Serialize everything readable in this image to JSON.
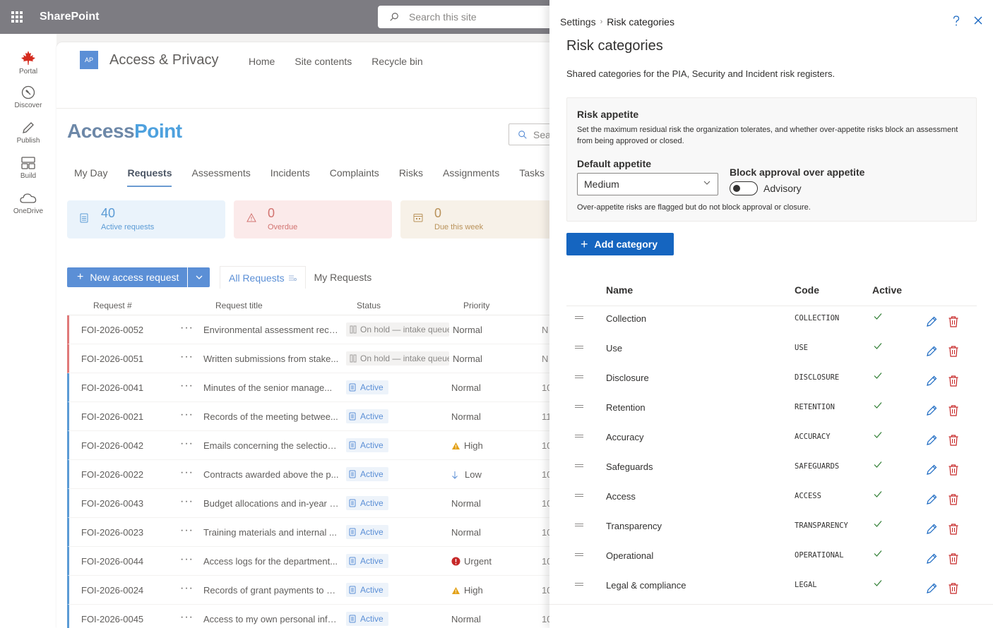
{
  "topbar": {
    "brand": "SharePoint",
    "search_placeholder": "Search this site"
  },
  "rail": [
    {
      "label": "Portal",
      "icon": "maple-leaf-icon"
    },
    {
      "label": "Discover",
      "icon": "compass-icon"
    },
    {
      "label": "Publish",
      "icon": "pen-icon"
    },
    {
      "label": "Build",
      "icon": "layout-icon"
    },
    {
      "label": "OneDrive",
      "icon": "cloud-icon"
    }
  ],
  "site": {
    "logo_text": "AP",
    "title": "Access & Privacy",
    "nav": [
      "Home",
      "Site contents",
      "Recycle bin"
    ]
  },
  "app": {
    "title_part1": "Access",
    "title_part2": "Point",
    "search_placeholder": "Sea",
    "tabs": [
      "My Day",
      "Requests",
      "Assessments",
      "Incidents",
      "Complaints",
      "Risks",
      "Assignments",
      "Tasks"
    ],
    "active_tab": "Requests",
    "kpis": [
      {
        "value": "40",
        "label": "Active requests",
        "tone": "blue"
      },
      {
        "value": "0",
        "label": "Overdue",
        "tone": "red"
      },
      {
        "value": "0",
        "label": "Due this week",
        "tone": "amber"
      }
    ],
    "new_request_label": "New access request",
    "view_tabs": [
      "All Requests",
      "My Requests"
    ],
    "grid_headers": {
      "request_no": "Request #",
      "title": "Request title",
      "status": "Status",
      "priority": "Priority"
    },
    "rows": [
      {
        "id": "FOI-2026-0052",
        "title": "Environmental assessment reco...",
        "status": "On hold — intake queue",
        "priority": "Normal",
        "extra": "N",
        "flag": "red",
        "status_kind": "hold",
        "priority_icon": ""
      },
      {
        "id": "FOI-2026-0051",
        "title": "Written submissions from stake...",
        "status": "On hold — intake queue",
        "priority": "Normal",
        "extra": "N",
        "flag": "red",
        "status_kind": "hold",
        "priority_icon": ""
      },
      {
        "id": "FOI-2026-0041",
        "title": "Minutes of the senior manage...",
        "status": "Active",
        "priority": "Normal",
        "extra": "10",
        "flag": "blue",
        "status_kind": "active",
        "priority_icon": ""
      },
      {
        "id": "FOI-2026-0021",
        "title": "Records of the meeting betwee...",
        "status": "Active",
        "priority": "Normal",
        "extra": "11",
        "flag": "blue",
        "status_kind": "active",
        "priority_icon": ""
      },
      {
        "id": "FOI-2026-0042",
        "title": "Emails concerning the selection...",
        "status": "Active",
        "priority": "High",
        "extra": "10",
        "flag": "blue",
        "status_kind": "active",
        "priority_icon": "warning"
      },
      {
        "id": "FOI-2026-0022",
        "title": "Contracts awarded above the p...",
        "status": "Active",
        "priority": "Low",
        "extra": "10",
        "flag": "blue",
        "status_kind": "active",
        "priority_icon": "down"
      },
      {
        "id": "FOI-2026-0043",
        "title": "Budget allocations and in-year r...",
        "status": "Active",
        "priority": "Normal",
        "extra": "10",
        "flag": "blue",
        "status_kind": "active",
        "priority_icon": ""
      },
      {
        "id": "FOI-2026-0023",
        "title": "Training materials and internal ...",
        "status": "Active",
        "priority": "Normal",
        "extra": "10",
        "flag": "blue",
        "status_kind": "active",
        "priority_icon": ""
      },
      {
        "id": "FOI-2026-0044",
        "title": "Access logs for the department...",
        "status": "Active",
        "priority": "Urgent",
        "extra": "10",
        "flag": "blue",
        "status_kind": "active",
        "priority_icon": "urgent"
      },
      {
        "id": "FOI-2026-0024",
        "title": "Records of grant payments to a...",
        "status": "Active",
        "priority": "High",
        "extra": "10",
        "flag": "blue",
        "status_kind": "active",
        "priority_icon": "warning"
      },
      {
        "id": "FOI-2026-0045",
        "title": "Access to my own personal info...",
        "status": "Active",
        "priority": "Normal",
        "extra": "10",
        "flag": "blue",
        "status_kind": "active",
        "priority_icon": ""
      }
    ]
  },
  "panel": {
    "breadcrumb_root": "Settings",
    "breadcrumb_sep": "›",
    "breadcrumb_current": "Risk categories",
    "title": "Risk categories",
    "description": "Shared categories for the PIA, Security and Incident risk registers.",
    "appetite": {
      "heading": "Risk appetite",
      "description": "Set the maximum residual risk the organization tolerates, and whether over-appetite risks block an assessment from being approved or closed.",
      "default_label": "Default appetite",
      "default_value": "Medium",
      "block_label": "Block approval over appetite",
      "toggle_label": "Advisory",
      "toggle_on": false,
      "note": "Over-appetite risks are flagged but do not block approval or closure."
    },
    "add_label": "Add category",
    "headers": {
      "name": "Name",
      "code": "Code",
      "active": "Active"
    },
    "categories": [
      {
        "name": "Collection",
        "code": "COLLECTION",
        "active": true
      },
      {
        "name": "Use",
        "code": "USE",
        "active": true
      },
      {
        "name": "Disclosure",
        "code": "DISCLOSURE",
        "active": true
      },
      {
        "name": "Retention",
        "code": "RETENTION",
        "active": true
      },
      {
        "name": "Accuracy",
        "code": "ACCURACY",
        "active": true
      },
      {
        "name": "Safeguards",
        "code": "SAFEGUARDS",
        "active": true
      },
      {
        "name": "Access",
        "code": "ACCESS",
        "active": true
      },
      {
        "name": "Transparency",
        "code": "TRANSPARENCY",
        "active": true
      },
      {
        "name": "Operational",
        "code": "OPERATIONAL",
        "active": true
      },
      {
        "name": "Legal & compliance",
        "code": "LEGAL",
        "active": true
      }
    ]
  },
  "colors": {
    "accent": "#1565c0",
    "check": "#2e7d32",
    "delete": "#c62828"
  }
}
